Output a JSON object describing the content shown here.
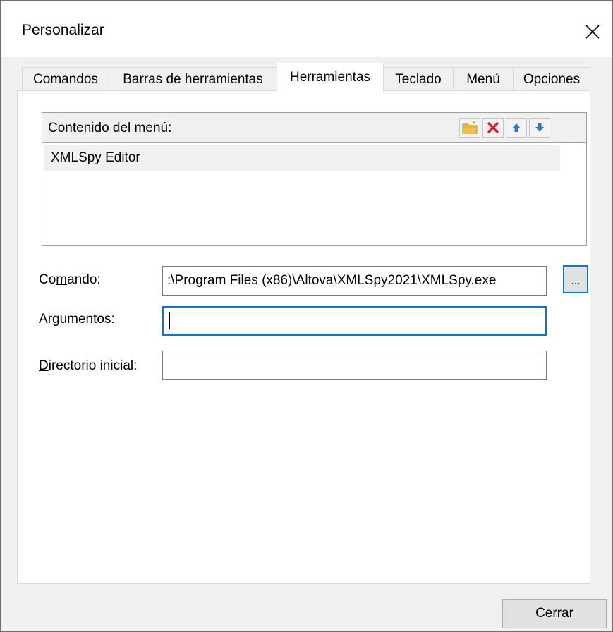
{
  "window": {
    "title": "Personalizar",
    "close_icon": "close-icon"
  },
  "tabs": [
    {
      "label": "Comandos"
    },
    {
      "label": "Barras de herramientas"
    },
    {
      "label": "Herramientas",
      "active": true
    },
    {
      "label": "Teclado"
    },
    {
      "label": "Menú"
    },
    {
      "label": "Opciones"
    }
  ],
  "menu_contents": {
    "label_prefix": "C",
    "label_rest": "ontenido del menú:",
    "toolbar": [
      {
        "icon": "new-folder-icon"
      },
      {
        "icon": "delete-icon"
      },
      {
        "icon": "arrow-up-icon"
      },
      {
        "icon": "arrow-down-icon"
      }
    ],
    "items": [
      "XMLSpy Editor"
    ]
  },
  "fields": {
    "command": {
      "label_before": "Co",
      "label_underlined": "m",
      "label_after": "ando:",
      "value": ":\\Program Files (x86)\\Altova\\XMLSpy2021\\XMLSpy.exe"
    },
    "arguments": {
      "label_underlined": "A",
      "label_after": "rgumentos:",
      "value": ""
    },
    "initial_directory": {
      "label_underlined": "D",
      "label_after": "irectorio inicial:",
      "value": ""
    },
    "browse_label": "..."
  },
  "footer": {
    "close_label": "Cerrar"
  },
  "colors": {
    "accent": "#0078d7",
    "delete_red": "#e81123",
    "arrow_blue": "#2f6fde"
  }
}
